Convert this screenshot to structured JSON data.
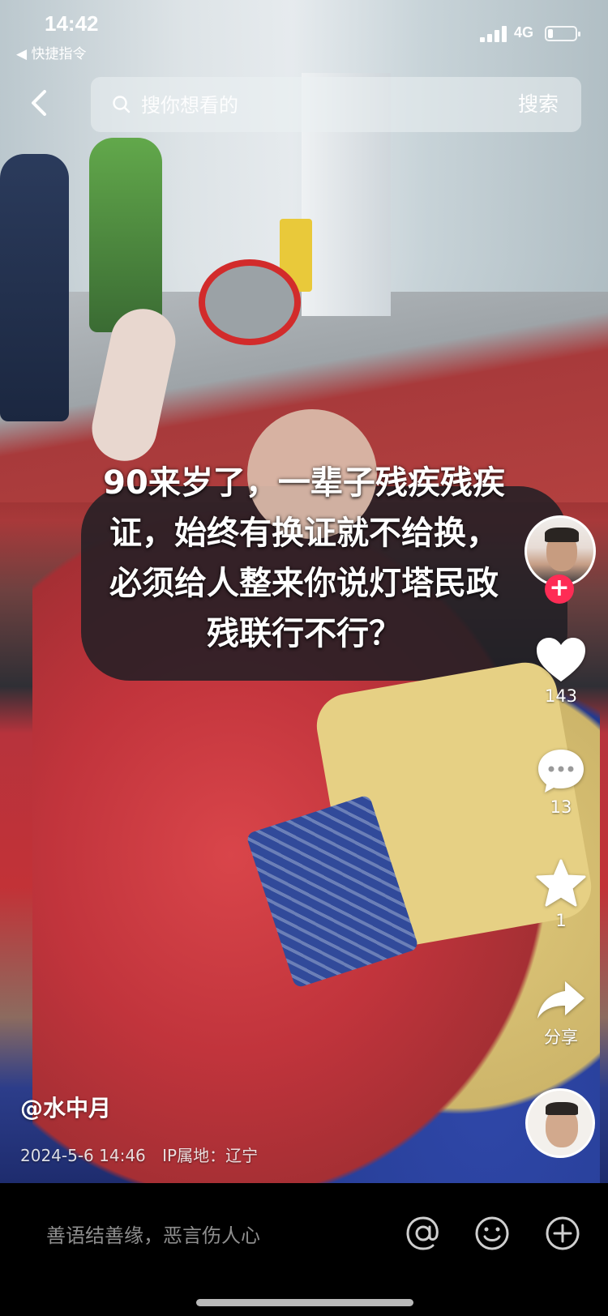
{
  "status_bar": {
    "time": "14:42",
    "back_app": "◀ 快捷指令",
    "network": "4G"
  },
  "search": {
    "placeholder": "搜你想看的",
    "button_label": "搜索"
  },
  "caption": "90来岁了，一辈子残疾残疾\n证，始终有换证就不给换，\n必须给人整来你说灯塔民政\n残联行不行？",
  "actions": {
    "likes": "143",
    "comments": "13",
    "favorites": "1",
    "share_label": "分享"
  },
  "post": {
    "author": "@水中月",
    "datetime": "2024-5-6 14:46",
    "ip_location": "IP属地：辽宁"
  },
  "comment_bar": {
    "placeholder": "善语结善缘，恶言伤人心"
  },
  "colors": {
    "follow_badge": "#fe2c55",
    "background": "#000000"
  },
  "icons": [
    "back-arrow-icon",
    "search-icon",
    "heart-icon",
    "comment-icon",
    "star-icon",
    "share-icon",
    "at-icon",
    "emoji-icon",
    "add-icon"
  ]
}
